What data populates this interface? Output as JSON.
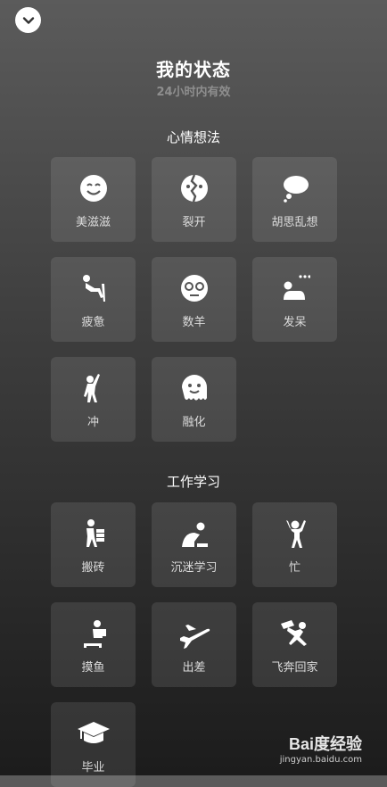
{
  "header": {
    "collapse_icon": "chevron-down-icon",
    "title": "我的状态",
    "subtitle": "24小时内有效"
  },
  "sections": [
    {
      "title": "心情想法",
      "items": [
        {
          "label": "美滋滋",
          "icon": "smile-face-icon"
        },
        {
          "label": "裂开",
          "icon": "cracked-face-icon"
        },
        {
          "label": "胡思乱想",
          "icon": "thought-bubble-icon"
        },
        {
          "label": "疲惫",
          "icon": "slumped-person-icon"
        },
        {
          "label": "数羊",
          "icon": "sleepy-face-icon"
        },
        {
          "label": "发呆",
          "icon": "daydream-person-icon"
        },
        {
          "label": "冲",
          "icon": "charging-person-icon"
        },
        {
          "label": "融化",
          "icon": "melting-face-icon"
        }
      ]
    },
    {
      "title": "工作学习",
      "items": [
        {
          "label": "搬砖",
          "icon": "carrying-bricks-icon"
        },
        {
          "label": "沉迷学习",
          "icon": "studying-person-icon"
        },
        {
          "label": "忙",
          "icon": "busy-person-icon"
        },
        {
          "label": "摸鱼",
          "icon": "slacking-person-icon"
        },
        {
          "label": "出差",
          "icon": "airplane-icon"
        },
        {
          "label": "飞奔回家",
          "icon": "running-home-icon"
        },
        {
          "label": "毕业",
          "icon": "graduation-cap-icon"
        }
      ]
    }
  ],
  "watermark": {
    "brand": "Bai度经验",
    "url": "jingyan.baidu.com"
  }
}
